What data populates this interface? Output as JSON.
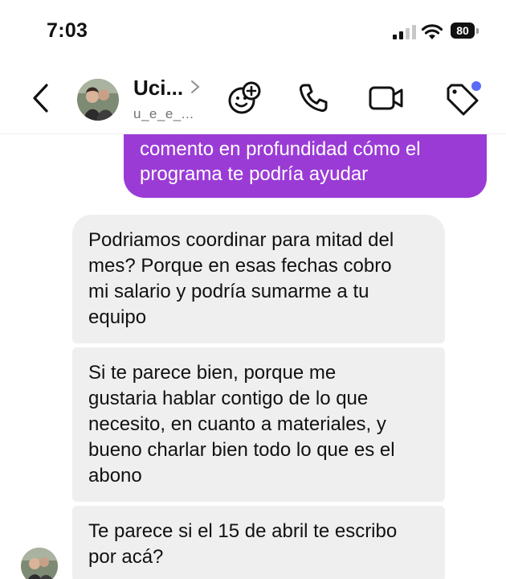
{
  "status_bar": {
    "time": "7:03",
    "battery": "80"
  },
  "header": {
    "contact_name": "Uci...",
    "username": "u_e_e_...",
    "actions": [
      "emoji-add-icon",
      "phone-icon",
      "video-camera-icon",
      "tag-icon"
    ],
    "notification_dot_color": "#5b6cf7"
  },
  "messages": [
    {
      "direction": "outgoing",
      "text": "comento en profundidad cómo el\nprograma te podría ayudar"
    },
    {
      "direction": "incoming",
      "text": "Podriamos coordinar para mitad del\nmes? Porque en esas fechas cobro\nmi salario y podría sumarme a tu\nequipo"
    },
    {
      "direction": "incoming",
      "text": "Si te parece bien, porque me\ngustaria hablar contigo de lo que\nnecesito, en cuanto a materiales, y\nbueno charlar bien todo lo que es el\nabono"
    },
    {
      "direction": "incoming",
      "text": "Te parece si el 15 de abril te escribo\npor acá?"
    }
  ],
  "colors": {
    "outgoing_bubble": "#9b3bd6",
    "incoming_bubble": "#efeff0"
  }
}
